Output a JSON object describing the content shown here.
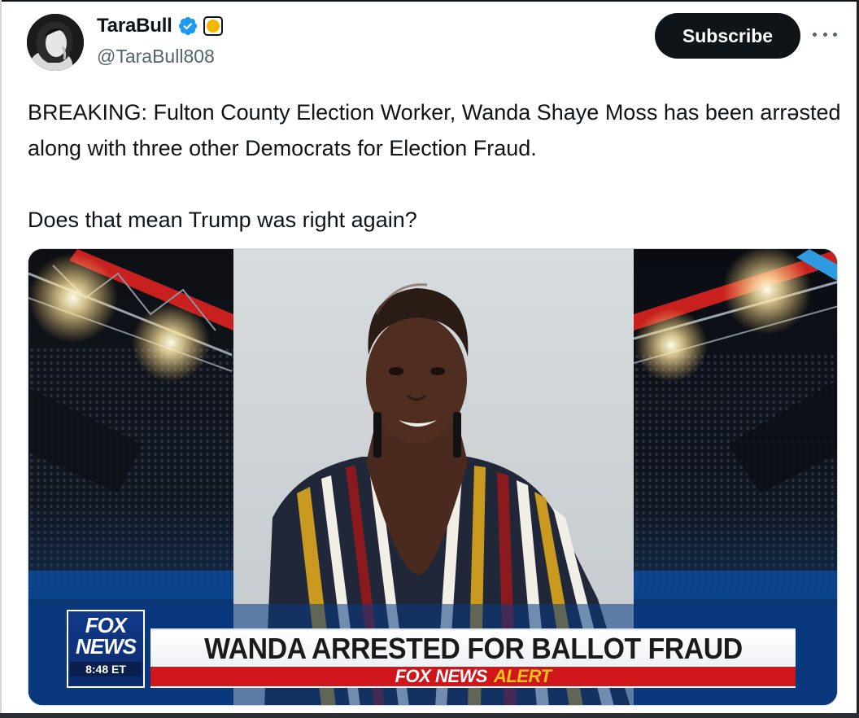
{
  "author": {
    "display_name": "TaraBull",
    "handle": "@TaraBull808",
    "verified_icon": "verified-badge-icon",
    "org_badge_icon": "gold-circle-badge-icon"
  },
  "actions": {
    "subscribe_label": "Subscribe",
    "more_icon": "more-horizontal-icon"
  },
  "tweet": {
    "line1": "BREAKING: Fulton County Election Worker, Wanda Shaye Moss has been arrəsted along with three other Democrats for Election Fraud.",
    "line2": "Does that mean Trump was right again?"
  },
  "media": {
    "logo_line1": "FOX",
    "logo_line2": "NEWS",
    "logo_time": "8:48 ET",
    "headline": "WANDA ARRESTED FOR BALLOT FRAUD",
    "alert_brand": "FOX NEWS",
    "alert_word": "ALERT"
  },
  "colors": {
    "accent_black": "#0f1419",
    "secondary_text": "#536471",
    "verified_blue": "#1d9bf0",
    "alert_red": "#d0161b",
    "alert_yellow": "#f6c31a"
  }
}
